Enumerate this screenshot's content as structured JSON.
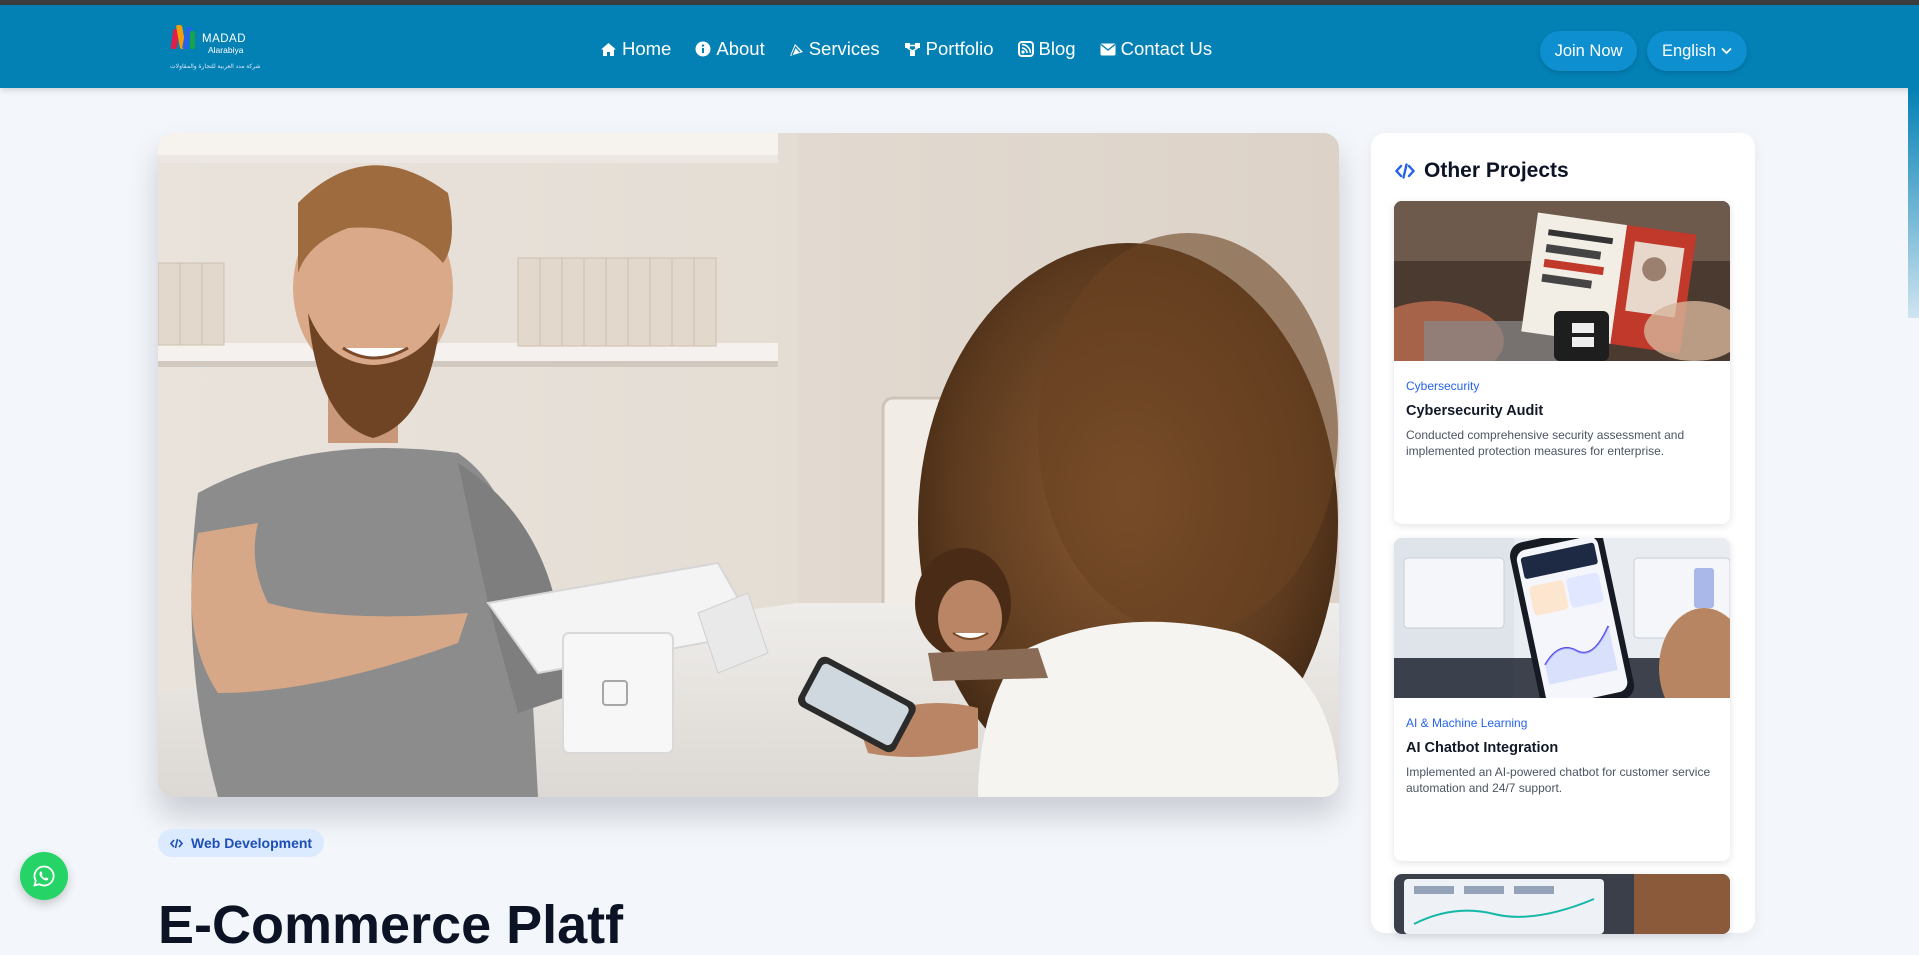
{
  "brand": {
    "name_line1": "MADAD",
    "name_line2": "Alarabiya",
    "arabic_tagline": "شركة مدد العربية للتجارة والمقاولات",
    "colors": {
      "header": "#0380b4",
      "button": "#0d8fd0",
      "accent": "#2563eb"
    }
  },
  "nav": {
    "items": [
      {
        "label": "Home",
        "icon": "home-icon"
      },
      {
        "label": "About",
        "icon": "info-icon"
      },
      {
        "label": "Services",
        "icon": "services-icon"
      },
      {
        "label": "Portfolio",
        "icon": "portfolio-icon"
      },
      {
        "label": "Blog",
        "icon": "blog-icon"
      },
      {
        "label": "Contact Us",
        "icon": "envelope-icon"
      }
    ],
    "join_label": "Join Now",
    "language_label": "English"
  },
  "project": {
    "category_tag": "Web Development",
    "title": "E-Commerce Platf"
  },
  "sidebar": {
    "title": "Other Projects",
    "cards": [
      {
        "category": "Cybersecurity",
        "title": "Cybersecurity Audit",
        "description": "Conducted comprehensive security assessment and implemented protection measures for enterprise."
      },
      {
        "category": "AI & Machine Learning",
        "title": "AI Chatbot Integration",
        "description": "Implemented an AI-powered chatbot for customer service automation and 24/7 support."
      }
    ]
  }
}
